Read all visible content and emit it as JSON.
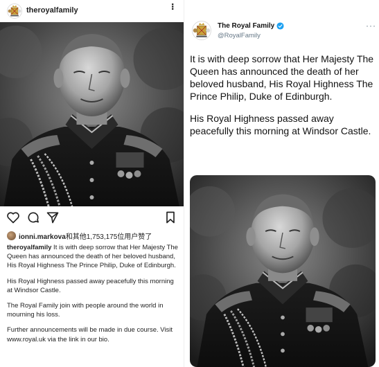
{
  "instagram": {
    "username": "theroyalfamily",
    "more_icon": "more-vertical-icon",
    "likes": {
      "prefix_user": "ionni.markova",
      "text": "和其他1,753,175位用户赞了"
    },
    "caption": {
      "username": "theroyalfamily",
      "paragraphs": [
        " It is with deep sorrow that Her Majesty The Queen has announced the death of her beloved husband, His Royal Highness The Prince Philip, Duke of Edinburgh.",
        "His Royal Highness passed away peacefully this morning at Windsor Castle.",
        "The Royal Family join with people around the world in mourning his loss.",
        "Further announcements will be made in due course. Visit www.royal.uk via the link in our bio."
      ]
    },
    "action_icons": [
      "heart-icon",
      "comment-icon",
      "share-icon",
      "bookmark-icon"
    ]
  },
  "twitter": {
    "display_name": "The Royal Family",
    "handle": "@RoyalFamily",
    "more": "···",
    "paragraphs": [
      "It is with deep sorrow that Her Majesty The Queen has announced the death of her beloved husband, His Royal Highness The Prince Philip, Duke of Edinburgh.",
      "His Royal Highness passed away peacefully this morning at Windsor Castle."
    ],
    "verified_color": "#1DA1F2"
  }
}
